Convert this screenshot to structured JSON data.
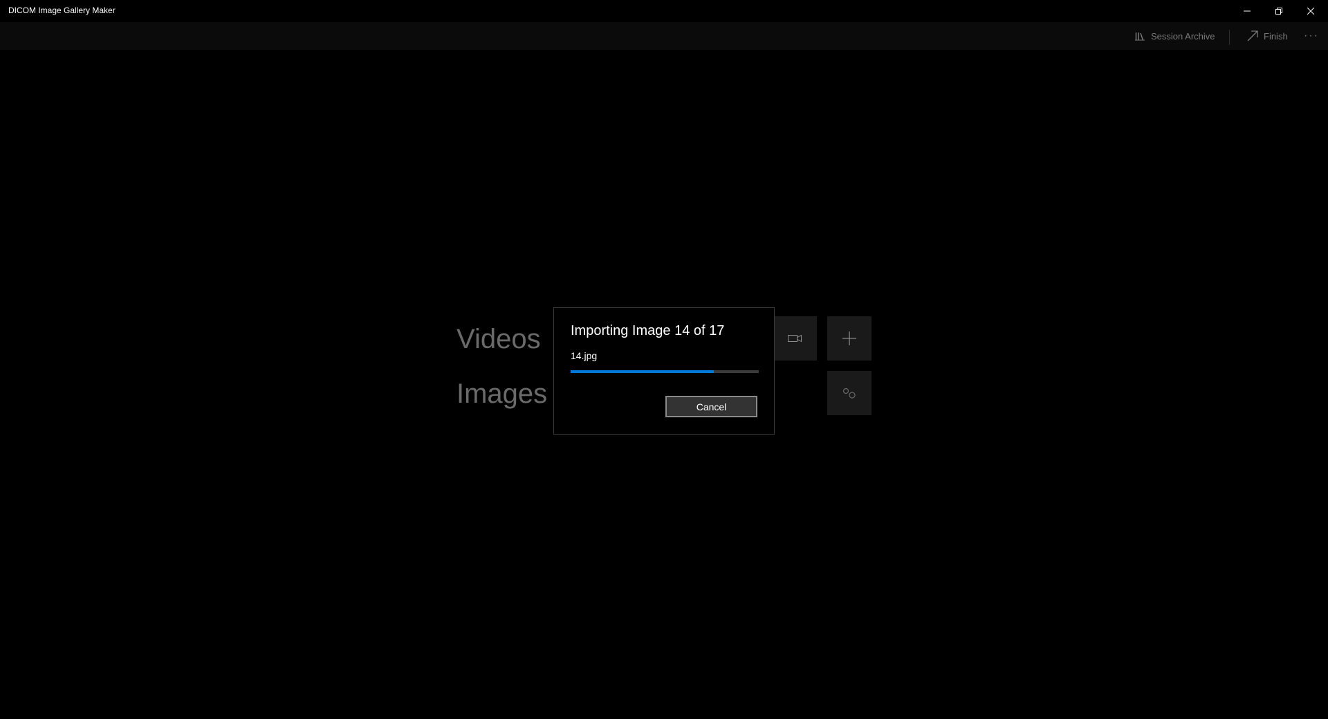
{
  "window": {
    "title": "DICOM Image Gallery Maker",
    "controls": [
      "minimize-icon",
      "restore-icon",
      "close-icon"
    ]
  },
  "command_bar": {
    "session_archive_label": "Session Archive",
    "session_archive_icon": "library-icon",
    "finish_label": "Finish",
    "finish_icon": "arrow-up-right-icon",
    "more_glyph": "···"
  },
  "main": {
    "videos_label": "Videos",
    "images_label": "Images",
    "tiles": [
      "video-camera-icon",
      "plus-icon",
      "settings-gears-icon"
    ]
  },
  "dialog": {
    "heading": "Importing Image 14 of 17",
    "filename": "14.jpg",
    "progress_fraction": 0.76,
    "cancel_label": "Cancel"
  },
  "colors": {
    "accent": "#0078d7",
    "background": "#000000",
    "dim_text": "#6a6a6a"
  }
}
